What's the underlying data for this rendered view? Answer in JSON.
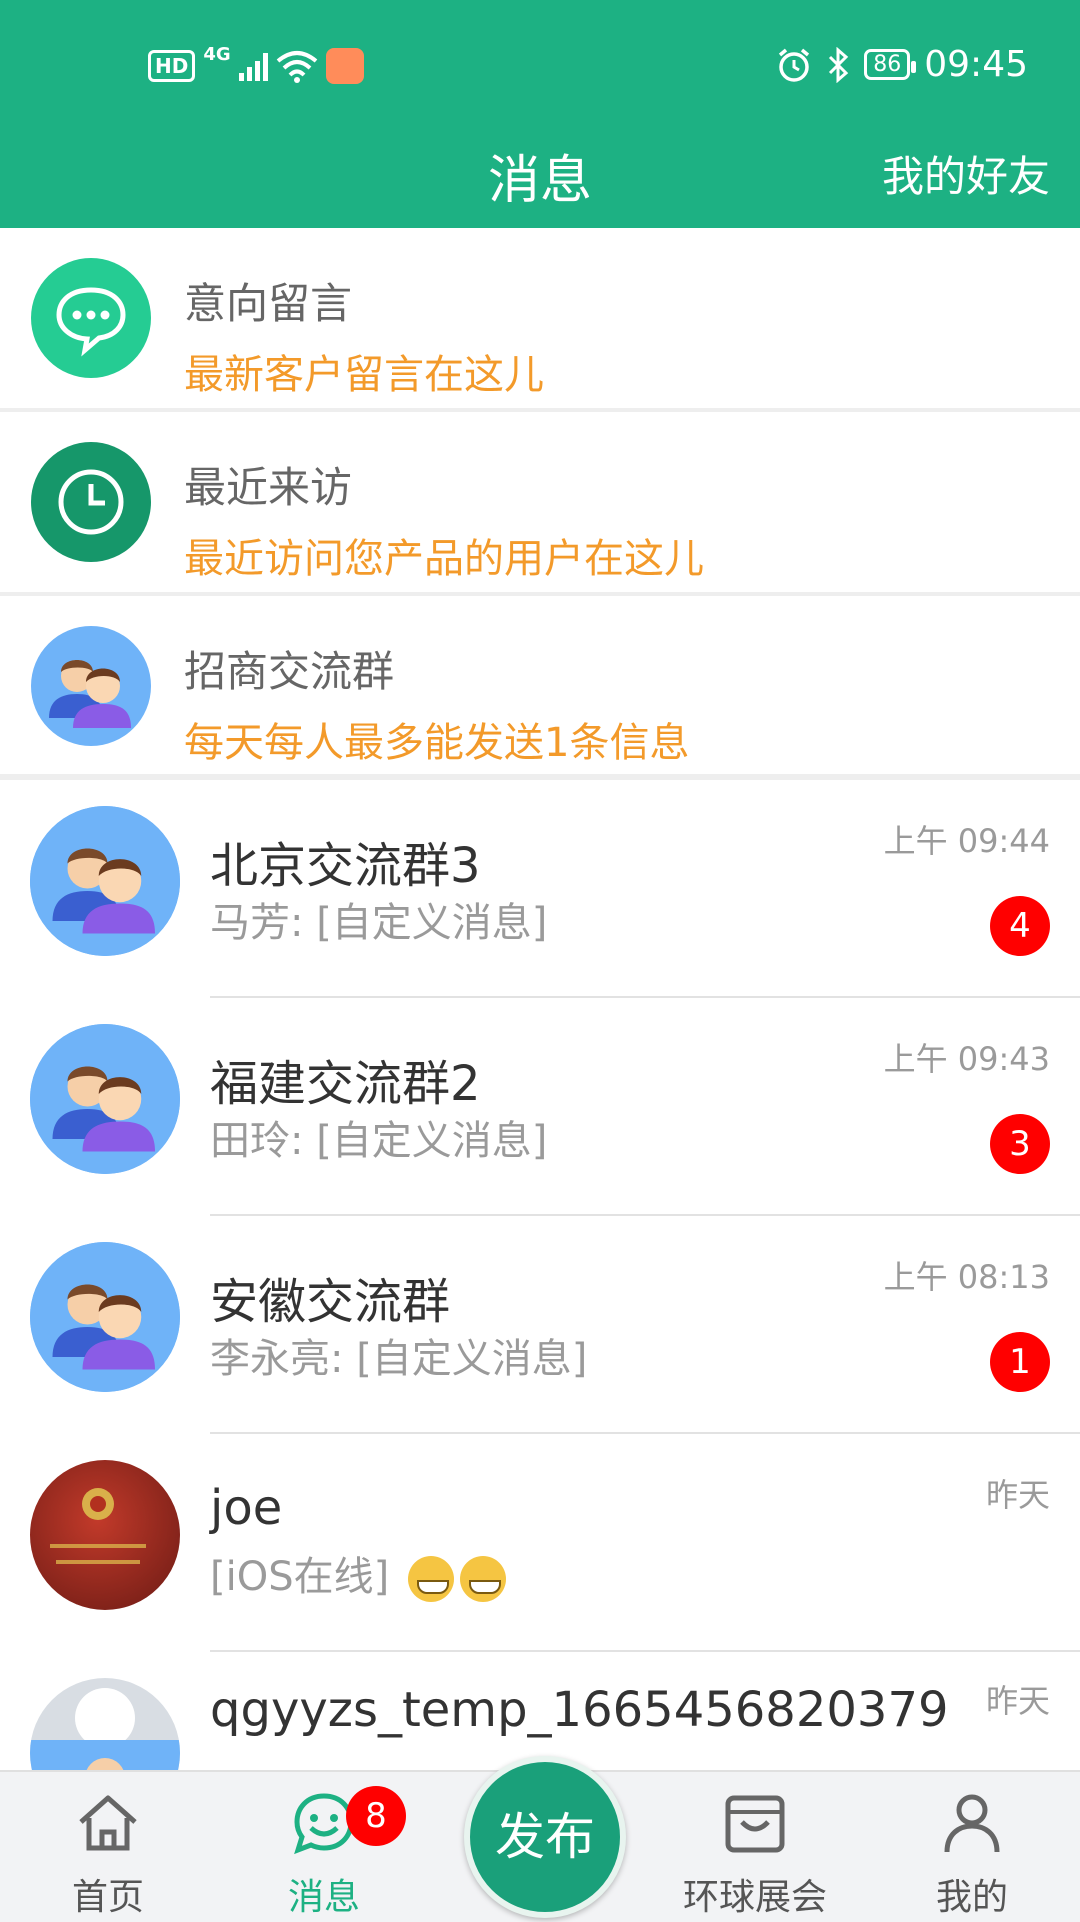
{
  "status_bar": {
    "hd": "HD",
    "network": "4G",
    "battery": "86",
    "time": "09:45"
  },
  "header": {
    "title": "消息",
    "friends_label": "我的好友"
  },
  "features": [
    {
      "title": "意向留言",
      "subtitle": "最新客户留言在这儿",
      "icon": "chat-bubble-icon"
    },
    {
      "title": "最近来访",
      "subtitle": "最近访问您产品的用户在这儿",
      "icon": "clock-icon"
    },
    {
      "title": "招商交流群",
      "subtitle": "每天每人最多能发送1条信息",
      "icon": "group-icon"
    }
  ],
  "conversations": [
    {
      "name": "北京交流群3",
      "message": "马芳: [自定义消息]",
      "time": "上午 09:44",
      "unread": "4"
    },
    {
      "name": "福建交流群2",
      "message": "田玲: [自定义消息]",
      "time": "上午 09:43",
      "unread": "3"
    },
    {
      "name": "安徽交流群",
      "message": "李永亮: [自定义消息]",
      "time": "上午 08:13",
      "unread": "1"
    },
    {
      "name": "joe",
      "message": "[iOS在线]",
      "time": "昨天"
    },
    {
      "name": "qgyyzs_temp_1665456820379",
      "time": "昨天"
    }
  ],
  "bottom_nav": {
    "home": "首页",
    "messages": "消息",
    "messages_badge": "8",
    "publish": "发布",
    "expo": "环球展会",
    "mine": "我的"
  },
  "colors": {
    "brand": "#1db183",
    "accent_orange": "#f39a2a",
    "badge_red": "#ff0000"
  }
}
